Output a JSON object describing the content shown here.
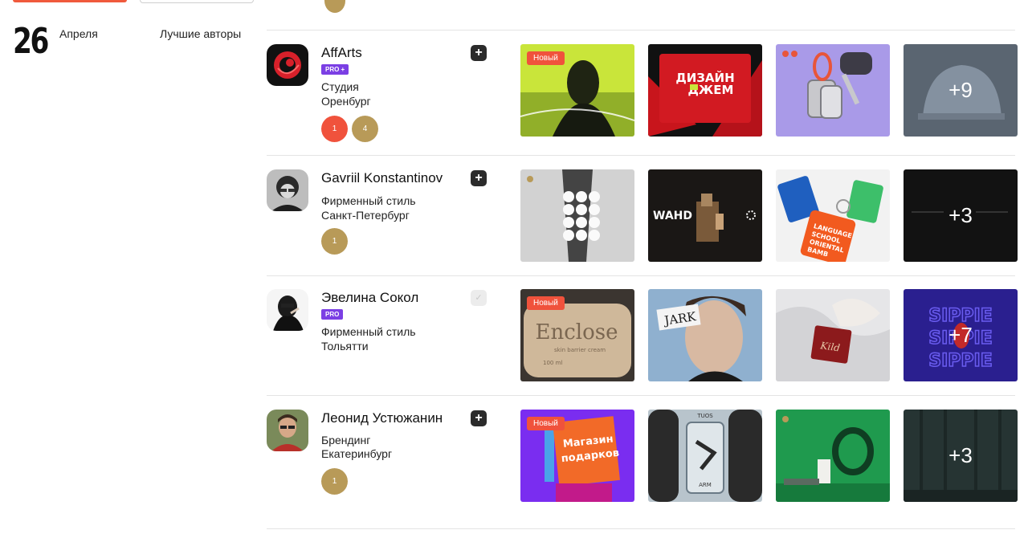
{
  "header": {
    "date_day": "26",
    "date_month": "Апреля",
    "section_label": "Лучшие авторы"
  },
  "authors": [
    {
      "name": "AffArts",
      "badge": "PRO +",
      "meta1": "Студия",
      "meta2": "Оренбург",
      "follow": "+",
      "medals": [
        "1",
        "4"
      ],
      "new_tag": "Новый",
      "more": "+9"
    },
    {
      "name": "Gavriil Konstantinov",
      "badge": "",
      "meta1": "Фирменный стиль",
      "meta2": "Санкт-Петербург",
      "follow": "+",
      "medals": [
        "1"
      ],
      "new_tag": "",
      "more": "+3"
    },
    {
      "name": "Эвелина Сокол",
      "badge": "PRO",
      "meta1": "Фирменный стиль",
      "meta2": "Тольятти",
      "follow": "✓",
      "medals": [],
      "new_tag": "Новый",
      "more": "+7"
    },
    {
      "name": "Леонид Устюжанин",
      "badge": "",
      "meta1": "Брендинг",
      "meta2": "Екатеринбург",
      "follow": "+",
      "medals": [
        "1"
      ],
      "new_tag": "Новый",
      "more": "+3"
    }
  ],
  "thumb_texts": {
    "dizayn": "ДИЗАЙН",
    "dzhem": "ДЖЕМ",
    "wahd": "WAHD",
    "enclose": "Enclose",
    "enclose_sub": "skin barrier cream",
    "enclose_vol": "100 ml",
    "jark": "JARK",
    "kild": "Kild",
    "sippie": "SIPPIE",
    "magazin": "Магазин",
    "podarkov": "подарков",
    "arm": "ARM",
    "tuos": "TUOS",
    "language": "LANGUAGE",
    "school": "SCHOOL",
    "oriental": "ORIENTAL",
    "bamb": "BAMB"
  },
  "colors": {
    "accent": "#f05a3c",
    "pro": "#7b3fe4",
    "medal_gold": "#b89a58",
    "medal_red": "#f0523c"
  }
}
